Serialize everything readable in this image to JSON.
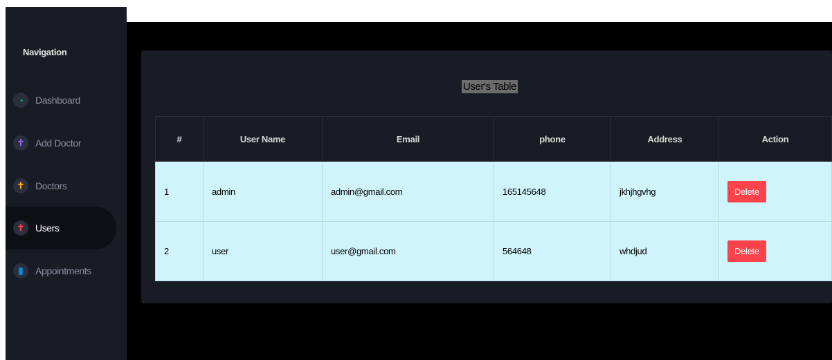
{
  "sidebar": {
    "title": "Navigation",
    "items": [
      {
        "label": "Dashboard",
        "icon": "speedometer-icon",
        "glyph": "◔",
        "color": "#00d25b"
      },
      {
        "label": "Add Doctor",
        "icon": "cross-icon",
        "glyph": "✝",
        "color": "#8f5fe8"
      },
      {
        "label": "Doctors",
        "icon": "cross-icon",
        "glyph": "✝",
        "color": "#ffab00"
      },
      {
        "label": "Users",
        "icon": "cross-icon",
        "glyph": "✝",
        "color": "#fc424a",
        "active": true
      },
      {
        "label": "Appointments",
        "icon": "book-icon",
        "glyph": "▮",
        "color": "#0090e7"
      }
    ]
  },
  "table": {
    "title": "User's Table",
    "headers": [
      "#",
      "User Name",
      "Email",
      "phone",
      "Address",
      "Action"
    ],
    "rows": [
      {
        "id": "1",
        "username": "admin",
        "email": "admin@gmail.com",
        "phone": "165145648",
        "address": "jkhjhgvhg",
        "action": "Delete"
      },
      {
        "id": "2",
        "username": "user",
        "email": "user@gmail.com",
        "phone": "564648",
        "address": "whdjud",
        "action": "Delete"
      }
    ]
  }
}
